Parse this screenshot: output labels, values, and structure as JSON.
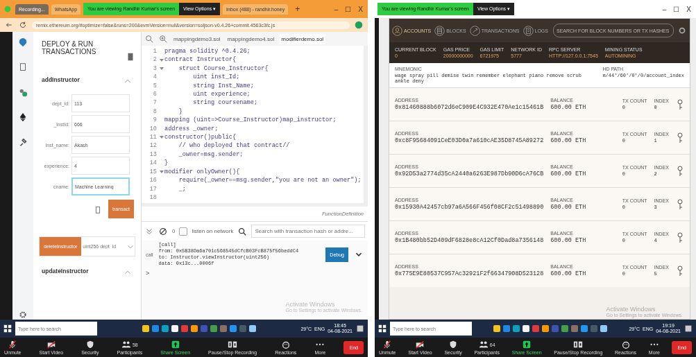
{
  "left_screen": {
    "window_controls": [
      "–",
      "☐",
      "X"
    ],
    "browser_tabs": [
      {
        "label": "Recording...",
        "selected": true
      },
      {
        "label": "WhatsApp",
        "selected": false
      }
    ],
    "banner": {
      "notice": "You are viewing Randhir Kumar's screen",
      "view_options": "View Options ▾"
    },
    "browser_tabs_after": [
      {
        "label": "Inbox (488) - randhir.honey",
        "selected": false
      }
    ],
    "new_tab": "+",
    "url": "remix.ethereum.org/#optimize=false&runs=200&evmVersion=null&version=soljson-v0.4.26+commit.4563c3fc.js",
    "deploy_panel": {
      "title": "DEPLOY & RUN TRANSACTIONS",
      "function_name": "addInstructor",
      "fields": [
        {
          "label": "dept_id:",
          "value": "113",
          "focused": false
        },
        {
          "label": "_instId:",
          "value": "666",
          "focused": false
        },
        {
          "label": "inst_name:",
          "value": "Akash",
          "focused": false
        },
        {
          "label": "experience:",
          "value": "4",
          "focused": false
        },
        {
          "label": "cname:",
          "value": "Machine Learning",
          "focused": true
        }
      ],
      "transact": "transact",
      "delete_button": "deleteInstructor",
      "delete_placeholder": "uint256 dept_id",
      "next_function": "updateInstructor"
    },
    "editor": {
      "tabs": [
        {
          "label": "mappingdemo3.sol",
          "selected": false
        },
        {
          "label": "mappingdemo4.sol",
          "selected": false
        },
        {
          "label": "modifierdemo.sol",
          "selected": true
        }
      ],
      "lines": [
        {
          "no": "1",
          "text": "pragma solidity ^0.4.26;",
          "foldable": false
        },
        {
          "no": "2",
          "text": "contract Instructor{",
          "foldable": true
        },
        {
          "no": "3",
          "text": "    struct Course_Instructor{",
          "foldable": true
        },
        {
          "no": "4",
          "text": "        uint inst_Id;",
          "foldable": false
        },
        {
          "no": "5",
          "text": "        string Inst_Name;",
          "foldable": false
        },
        {
          "no": "6",
          "text": "        uint experience;",
          "foldable": false
        },
        {
          "no": "7",
          "text": "        string coursename;",
          "foldable": false
        },
        {
          "no": "8",
          "text": "    }",
          "foldable": false
        },
        {
          "no": "9",
          "text": "mapping (uint=>Course_Instructor)map_instructor;",
          "foldable": false
        },
        {
          "no": "10",
          "text": "address _owner;",
          "foldable": false
        },
        {
          "no": "11",
          "text": "constructor()public{",
          "foldable": true
        },
        {
          "no": "12",
          "text": "    // who deployed that contract//",
          "foldable": false
        },
        {
          "no": "13",
          "text": "    _owner=msg.sender;",
          "foldable": false
        },
        {
          "no": "14",
          "text": "}",
          "foldable": false
        },
        {
          "no": "15",
          "text": "modifier onlyOwner(){",
          "foldable": true
        },
        {
          "no": "16",
          "text": "    require(_owner==msg.sender,\"you are not an owner\");",
          "foldable": false
        },
        {
          "no": "17",
          "text": "    _;",
          "foldable": false
        },
        {
          "no": "18",
          "foldable": false
        }
      ],
      "status": "FunctionDefinition"
    },
    "terminal": {
      "count": "0",
      "listen": {
        "label": "listen on network",
        "checked": false
      },
      "search_placeholder": "Search with transaction hash or addre...",
      "log": {
        "tag": "call",
        "lines": [
          "[call]",
          "from: 0x5B38Da6a701c568545dCfcB03FcB875f56beddC4",
          "to: Instructor.viewInstructor(uint256)",
          "data: 0x13c...0006f"
        ],
        "debug": "Debug"
      },
      "prompt": ">",
      "activation": {
        "title": "Activate Windows",
        "hint": "Go to Settings to activate Windows."
      }
    },
    "taskbar": {
      "search_placeholder": "Type here to search",
      "weather": "29°C",
      "language": "ENG",
      "time": "18:45",
      "date": "04-08-2021"
    },
    "meeting_controls": [
      {
        "label": "Unmute",
        "kind": "mic"
      },
      {
        "label": "Start Video",
        "kind": "video"
      },
      {
        "label": "Security",
        "kind": "shield"
      },
      {
        "label": "Participants",
        "kind": "people",
        "count": "58"
      },
      {
        "label": "Share Screen",
        "kind": "share"
      },
      {
        "label": "Pause/Stop Recording",
        "kind": "record"
      },
      {
        "label": "Reactions",
        "kind": "reaction"
      },
      {
        "label": "More",
        "kind": "more"
      }
    ],
    "end": "End"
  },
  "right_screen": {
    "banner": {
      "notice": "You are viewing Randhir Kumar's screen",
      "view_options": "View Options ▾"
    },
    "window_controls": [
      "–",
      "☐",
      "X"
    ],
    "ganache": {
      "nav": [
        {
          "label": "ACCOUNTS",
          "kind": "accounts",
          "selected": true
        },
        {
          "label": "BLOCKS",
          "kind": "blocks",
          "selected": false
        },
        {
          "label": "TRANSACTIONS",
          "kind": "transactions",
          "selected": false
        },
        {
          "label": "LOGS",
          "kind": "logs",
          "selected": false
        }
      ],
      "search_placeholder": "SEARCH FOR BLOCK NUMBERS OR TX HASHES",
      "stats": [
        {
          "label": "CURRENT BLOCK",
          "value": "0"
        },
        {
          "label": "GAS PRICE",
          "value": "20000000000"
        },
        {
          "label": "GAS LIMIT",
          "value": "6721975"
        },
        {
          "label": "NETWORK ID",
          "value": "5777"
        },
        {
          "label": "RPC SERVER",
          "value": "HTTP://127.0.0.1:7545"
        },
        {
          "label": "MINING STATUS",
          "value": "AUTOMINING"
        }
      ],
      "mnemonic": {
        "label": "MNEMONIC",
        "words": "wage spray pill demise twin remember elephant piano remove scrub ankle deny"
      },
      "hd_path": {
        "label": "HD PATH",
        "value": "m/44'/60'/0'/0/account_index"
      },
      "accounts": [
        {
          "address_label": "ADDRESS",
          "address": "0x81460888b6072d6eC909E4C932E470Ae1c15461B",
          "balance_label": "BALANCE",
          "balance": "600.00 ETH",
          "tx_label": "TX COUNT",
          "tx_count": "0",
          "index_label": "INDEX",
          "index": "0"
        },
        {
          "address_label": "ADDRESS",
          "address": "0xc8F95684091CeE03D0a7a610cAE35D8745A89272",
          "balance_label": "BALANCE",
          "balance": "600.00 ETH",
          "tx_label": "TX COUNT",
          "tx_count": "0",
          "index_label": "INDEX",
          "index": "1"
        },
        {
          "address_label": "ADDRESS",
          "address": "0x92D53a2774d35cA2440a6263E987Db90D6cA76CB",
          "balance_label": "BALANCE",
          "balance": "600.00 ETH",
          "tx_label": "TX COUNT",
          "tx_count": "0",
          "index_label": "INDEX",
          "index": "2"
        },
        {
          "address_label": "ADDRESS",
          "address": "0x15930A42457cb97a6A566F456f08CF2c51498890",
          "balance_label": "BALANCE",
          "balance": "600.00 ETH",
          "tx_label": "TX COUNT",
          "tx_count": "0",
          "index_label": "INDEX",
          "index": "3"
        },
        {
          "address_label": "ADDRESS",
          "address": "0x1B480bb52D409dF6828e8cA12Cf0Dad8a7356148",
          "balance_label": "BALANCE",
          "balance": "600.00 ETH",
          "tx_label": "TX COUNT",
          "tx_count": "0",
          "index_label": "INDEX",
          "index": "4"
        },
        {
          "address_label": "ADDRESS",
          "address": "0x775E9E80537C957Ac32921F2f66347908D523128",
          "balance_label": "BALANCE",
          "balance": "600.00 ETH",
          "tx_label": "TX COUNT",
          "tx_count": "0",
          "index_label": "INDEX",
          "index": "5"
        }
      ]
    },
    "activation": {
      "title": "Activate Windows",
      "hint": "Go to Settings to activate Windows."
    },
    "taskbar": {
      "search_placeholder": "Type here to search",
      "weather": "29°C",
      "language": "ENG",
      "time": "19:19",
      "date": "04-08-2021"
    },
    "meeting_controls": [
      {
        "label": "Unmute",
        "kind": "mic"
      },
      {
        "label": "Start Video",
        "kind": "video"
      },
      {
        "label": "Security",
        "kind": "shield"
      },
      {
        "label": "Participants",
        "kind": "people",
        "count": "64"
      },
      {
        "label": "Share Screen",
        "kind": "share"
      },
      {
        "label": "Pause/Stop Recording",
        "kind": "record"
      },
      {
        "label": "Reactions",
        "kind": "reaction"
      },
      {
        "label": "More",
        "kind": "more"
      }
    ],
    "end": "End"
  }
}
